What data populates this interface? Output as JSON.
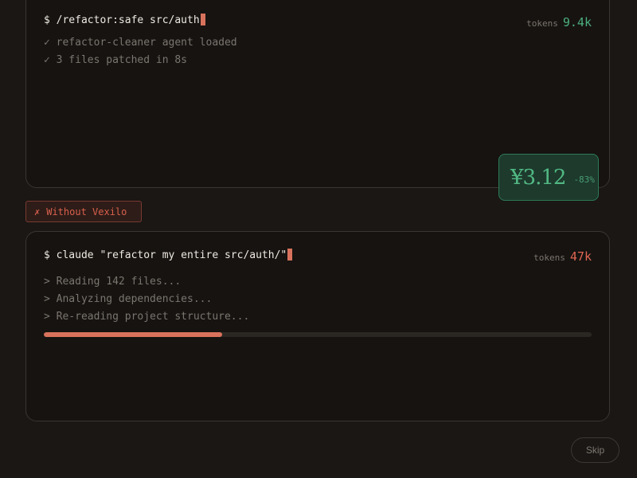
{
  "top_panel": {
    "command": "$ /refactor:safe src/auth",
    "tokens_label": "tokens",
    "tokens_value": "9.4k",
    "log": [
      "✓ refactor-cleaner agent loaded",
      "✓ 3 files patched in 8s"
    ]
  },
  "price_badge": {
    "amount": "¥3.12",
    "percent": "-83%"
  },
  "without_tag": {
    "icon": "x-icon",
    "glyph": "✗",
    "label": "Without Vexilo"
  },
  "bottom_panel": {
    "command": "$ claude \"refactor my entire src/auth/\"",
    "tokens_label": "tokens",
    "tokens_value": "47k",
    "log": [
      "> Reading 142 files...",
      "> Analyzing dependencies...",
      "> Re-reading project structure..."
    ],
    "progress_fraction": 0.326
  },
  "skip_label": "Skip",
  "colors": {
    "background": "#1a1715",
    "accent_red": "#df6652",
    "accent_green": "#4caf7d",
    "cursor": "#d9725c"
  }
}
